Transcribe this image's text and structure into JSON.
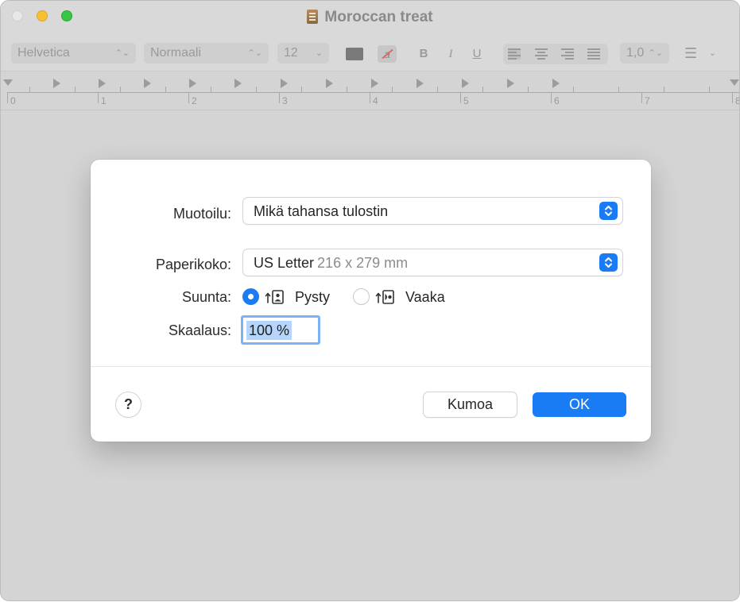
{
  "window": {
    "title": "Moroccan treat"
  },
  "toolbar": {
    "font_family": "Helvetica",
    "font_style": "Normaali",
    "font_size": "12",
    "bold": "B",
    "italic": "I",
    "underline": "U",
    "line_spacing": "1,0"
  },
  "ruler": {
    "numbers": [
      "0",
      "1",
      "2",
      "3",
      "4",
      "5",
      "6",
      "7",
      "8"
    ]
  },
  "dialog": {
    "format_label": "Muotoilu:",
    "format_value": "Mikä tahansa tulostin",
    "paper_label": "Paperikoko:",
    "paper_value": "US Letter",
    "paper_dims": "216 x 279 mm",
    "orientation_label": "Suunta:",
    "portrait_label": "Pysty",
    "landscape_label": "Vaaka",
    "portrait_selected": true,
    "scale_label": "Skaalaus:",
    "scale_value": "100 %",
    "help_label": "?",
    "cancel_label": "Kumoa",
    "ok_label": "OK"
  },
  "colors": {
    "accent": "#1a7cf5",
    "window_bg": "#d4d4d4",
    "dialog_bg": "#ffffff"
  }
}
